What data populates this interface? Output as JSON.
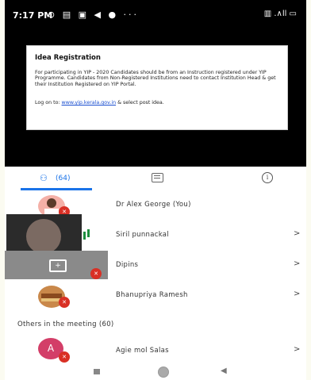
{
  "status_bar": {
    "time": "7:17 PM",
    "left_icons": "⊙ ▤ ▣ ◀ ● ···",
    "right_icons": "▥ .∧ll ▭"
  },
  "slide": {
    "title": "Idea Registration",
    "body": "For participating in YIP - 2020 Candidates should be from an Instruction registered under YIP Programme. Candidates from Non-Registered Institutions need to contact Institution Head & get their Institution Registered on YIP Portal.",
    "link_prefix": "Log on to: ",
    "link_text": "www.yip.kerala.gov.in",
    "link_suffix": " & select post idea."
  },
  "tabs": {
    "people_count": "(64)",
    "info_glyph": "i"
  },
  "participants": [
    {
      "name": "Dr Alex George (You)"
    },
    {
      "name": "Siril punnackal"
    },
    {
      "name": "Dipins"
    },
    {
      "name": "Bhanupriya Ramesh"
    }
  ],
  "others_label": "Others in the meeting (60)",
  "others": [
    {
      "name": "Agie mol Salas",
      "initial": "A"
    }
  ],
  "chevron": ">",
  "colors": {
    "accent": "#1a73e8",
    "mic_off": "#d93025",
    "avatar_a": "#d33e68"
  }
}
